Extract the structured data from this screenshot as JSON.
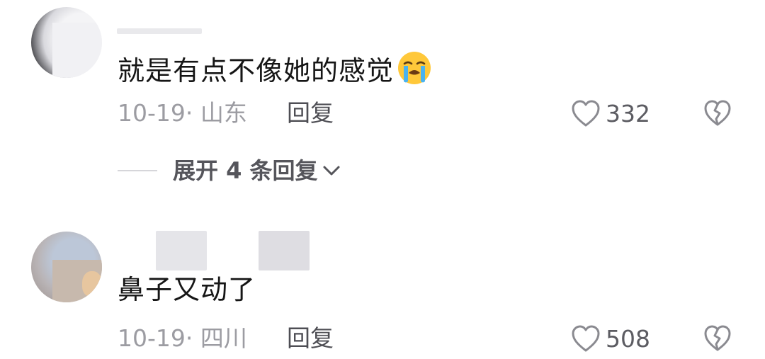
{
  "comments": [
    {
      "text": "就是有点不像她的感觉",
      "emoji_icon": "loudly-crying-face-icon",
      "date_location": "10-19· 山东",
      "reply_label": "回复",
      "like_count": "332",
      "expand_label": "展开 4 条回复"
    },
    {
      "text": "鼻子又动了",
      "date_location": "10-19· 四川",
      "reply_label": "回复",
      "like_count": "508"
    }
  ],
  "icons": {
    "like": "heart-outline-icon",
    "dislike": "broken-heart-icon",
    "expand": "chevron-down-icon"
  },
  "colors": {
    "text_primary": "#161616",
    "text_meta": "#9c9ca2",
    "icon_gray": "#8a8a90"
  }
}
